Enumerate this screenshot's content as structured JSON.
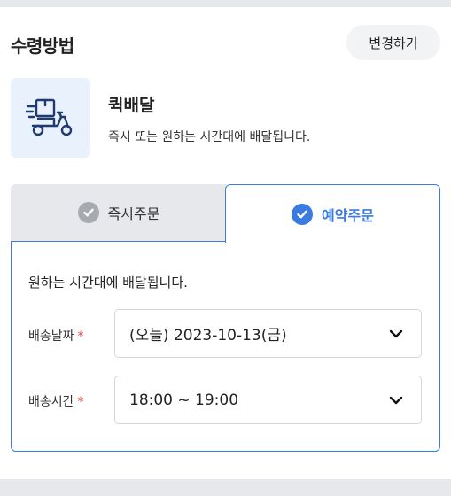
{
  "header": {
    "title": "수령방법",
    "change_label": "변경하기"
  },
  "method": {
    "icon": "delivery-scooter-icon",
    "title": "퀵배달",
    "description": "즉시 또는 원하는 시간대에 배달됩니다."
  },
  "tabs": [
    {
      "label": "즉시주문",
      "selected": false
    },
    {
      "label": "예약주문",
      "selected": true
    }
  ],
  "panel": {
    "description": "원하는 시간대에 배달됩니다.",
    "date_label": "배송날짜",
    "date_value": "(오늘) 2023-10-13(금)",
    "time_label": "배송시간",
    "time_value": "18:00 ~ 19:00",
    "required_mark": "*"
  },
  "colors": {
    "accent": "#3a7be0",
    "required": "#e0463d",
    "tab_inactive_bg": "#e6e8eb",
    "icon_box_bg": "#e8f1fc"
  }
}
